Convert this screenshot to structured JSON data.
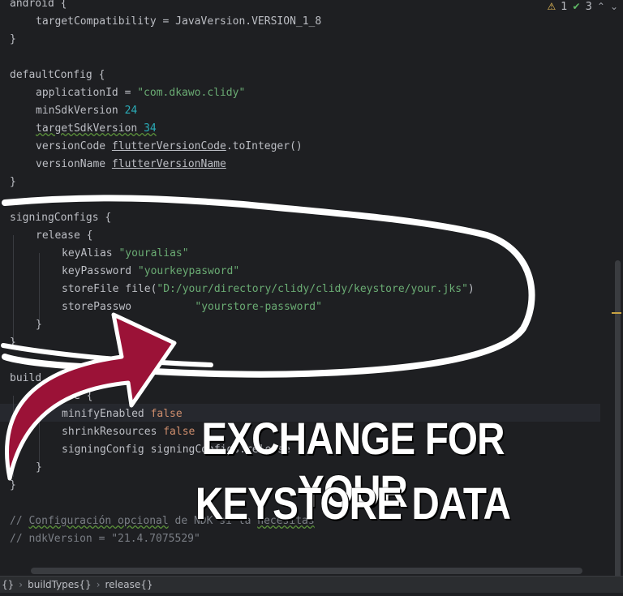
{
  "inspection": {
    "warnings": "1",
    "ok_count": "3"
  },
  "code_lines": [
    {
      "indent": 0,
      "parts": [
        {
          "t": "android {"
        }
      ]
    },
    {
      "indent": 1,
      "parts": [
        {
          "t": "targetCompatibility = JavaVersion.VERSION_1_8"
        }
      ]
    },
    {
      "indent": 0,
      "parts": [
        {
          "t": "}"
        }
      ]
    },
    {
      "indent": 0,
      "parts": []
    },
    {
      "indent": 0,
      "parts": [
        {
          "t": "defaultConfig {"
        }
      ]
    },
    {
      "indent": 1,
      "parts": [
        {
          "t": "applicationId = "
        },
        {
          "t": "\"com.dkawo.clidy\"",
          "c": "str"
        }
      ]
    },
    {
      "indent": 1,
      "parts": [
        {
          "t": "minSdkVersion "
        },
        {
          "t": "24",
          "c": "num"
        }
      ]
    },
    {
      "indent": 1,
      "parts": [
        {
          "t": "targetSdkVersion ",
          "c": "squig"
        },
        {
          "t": "34",
          "c": "num squig"
        }
      ]
    },
    {
      "indent": 1,
      "parts": [
        {
          "t": "versionCode "
        },
        {
          "t": "flutterVersionCode",
          "c": "uline"
        },
        {
          "t": ".toInteger()"
        }
      ]
    },
    {
      "indent": 1,
      "parts": [
        {
          "t": "versionName "
        },
        {
          "t": "flutterVersionName",
          "c": "uline"
        }
      ]
    },
    {
      "indent": 0,
      "parts": [
        {
          "t": "}"
        }
      ]
    },
    {
      "indent": 0,
      "parts": []
    },
    {
      "indent": 0,
      "parts": [
        {
          "t": "signingConfigs {"
        }
      ]
    },
    {
      "indent": 1,
      "parts": [
        {
          "t": "release {"
        }
      ]
    },
    {
      "indent": 2,
      "parts": [
        {
          "t": "keyAlias "
        },
        {
          "t": "\"youralias\"",
          "c": "str"
        }
      ]
    },
    {
      "indent": 2,
      "parts": [
        {
          "t": "keyPassword "
        },
        {
          "t": "\"yourkeypasword\"",
          "c": "str"
        }
      ]
    },
    {
      "indent": 2,
      "parts": [
        {
          "t": "storeFile file("
        },
        {
          "t": "\"D:/your/directory/clidy/clidy/keystore/your.jks\"",
          "c": "str"
        },
        {
          "t": ")"
        }
      ]
    },
    {
      "indent": 2,
      "parts": [
        {
          "t": "storePasswo"
        },
        {
          "t": "          "
        },
        {
          "t": "\"yourstore-password\"",
          "c": "str"
        }
      ]
    },
    {
      "indent": 1,
      "parts": [
        {
          "t": "}"
        }
      ]
    },
    {
      "indent": 0,
      "parts": [
        {
          "t": "}"
        }
      ]
    },
    {
      "indent": 0,
      "parts": []
    },
    {
      "indent": 0,
      "parts": [
        {
          "t": "build"
        }
      ]
    },
    {
      "indent": 1,
      "parts": [
        {
          "t": "    ase {"
        }
      ]
    },
    {
      "indent": 2,
      "parts": [
        {
          "t": "minifyEnabled "
        },
        {
          "t": "false",
          "c": "kw"
        }
      ]
    },
    {
      "indent": 2,
      "parts": [
        {
          "t": "shrinkResources "
        },
        {
          "t": "false",
          "c": "kw"
        }
      ]
    },
    {
      "indent": 2,
      "parts": [
        {
          "t": "signingConfig signingConfigs.release"
        }
      ]
    },
    {
      "indent": 1,
      "parts": [
        {
          "t": "}"
        }
      ]
    },
    {
      "indent": 0,
      "parts": [
        {
          "t": "}"
        }
      ]
    },
    {
      "indent": 0,
      "parts": []
    },
    {
      "indent": 0,
      "parts": [
        {
          "t": "// ",
          "c": "cmt"
        },
        {
          "t": "Configuración opcional",
          "c": "cmt squig"
        },
        {
          "t": " de NDK si la ",
          "c": "cmt"
        },
        {
          "t": "necesitas",
          "c": "cmt squig"
        }
      ]
    },
    {
      "indent": 0,
      "parts": [
        {
          "t": "// ndkVersion = \"21.4.7075529\"",
          "c": "cmt"
        }
      ]
    }
  ],
  "overlay": {
    "line1": "EXCHANGE FOR YOUR",
    "line2": "KEYSTORE DATA"
  },
  "breadcrumbs": [
    "{}",
    "buildTypes{}",
    "release{}"
  ],
  "colors": {
    "arrow": "#9b1237",
    "scribble": "#ffffff",
    "keyword": "#cf8e6d"
  }
}
